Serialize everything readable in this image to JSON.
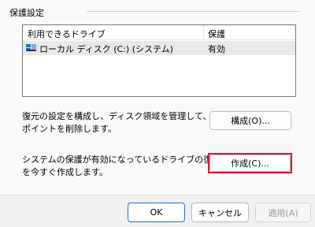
{
  "group": {
    "title": "保護設定"
  },
  "drive_list": {
    "headers": [
      "利用できるドライブ",
      "保護"
    ],
    "rows": [
      {
        "name": "ローカル ディスク (C:) (システム)",
        "protection": "有効",
        "icon": "drive-icon"
      }
    ]
  },
  "configure": {
    "description_line1": "復元の設定を構成し、ディスク領域を管理して、復元",
    "description_line2": "ポイントを削除します。",
    "button_label": "構成(O)..."
  },
  "create": {
    "description_line1": "システムの保護が有効になっているドライブの復元ポイント",
    "description_line2": "を今すぐ作成します。",
    "button_label": "作成(C)..."
  },
  "footer": {
    "ok_label": "OK",
    "cancel_label": "キャンセル",
    "apply_label": "適用(A)"
  },
  "colors": {
    "highlight": "#e0142c",
    "accent_border": "#2a6ccd",
    "selected_row": "#e8e8e8"
  }
}
